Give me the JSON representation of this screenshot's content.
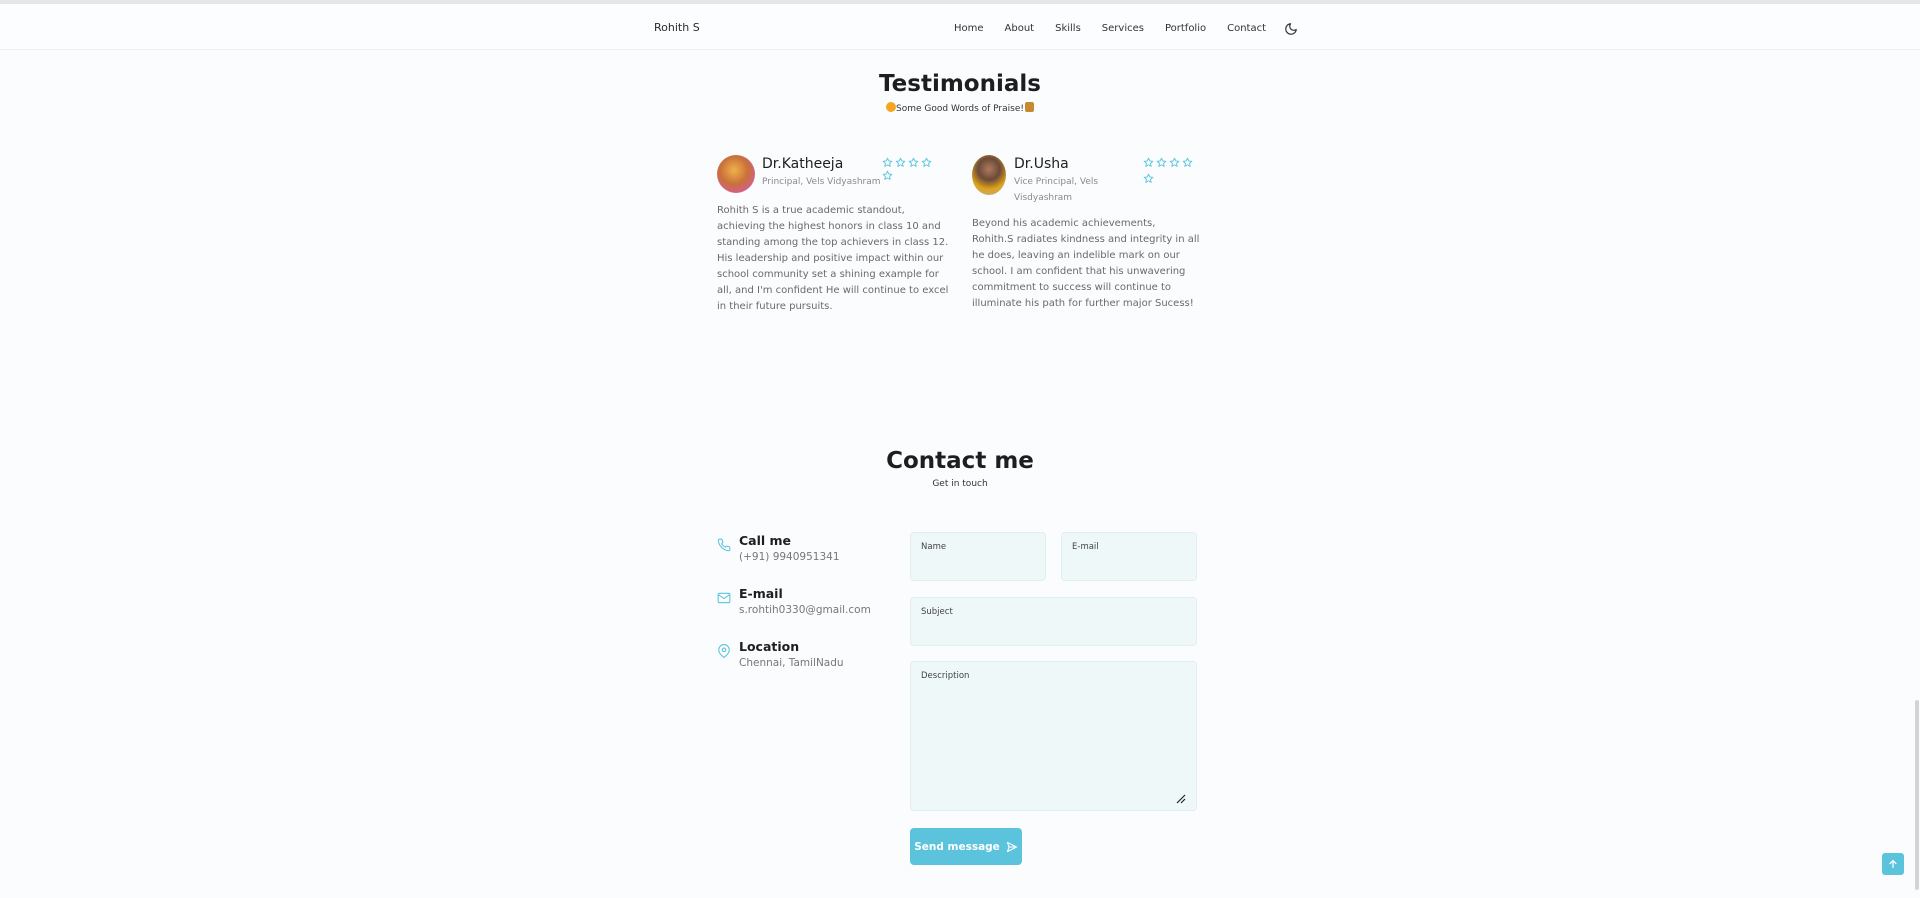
{
  "colors": {
    "accent": "#5bc4dc",
    "field_bg": "#eef8f9"
  },
  "header": {
    "brand": "Rohith S",
    "links": [
      "Home",
      "About",
      "Skills",
      "Services",
      "Portfolio",
      "Contact"
    ],
    "theme_icon": "moon-icon"
  },
  "testimonials": {
    "title": "Testimonials",
    "subtitle": "Some Good Words of Praise!",
    "items": [
      {
        "name": "Dr.Katheeja",
        "role": "Principal, Vels Vidyashram",
        "rating": 5,
        "text": "Rohith S is a true academic standout, achieving the highest honors in class 10 and standing among the top achievers in class 12. His leadership and positive impact within our school community set a shining example for all, and I'm confident He will continue to excel in their future pursuits."
      },
      {
        "name": "Dr.Usha",
        "role": "Vice Principal, Vels Visdyashram",
        "rating": 5,
        "text": "Beyond his academic achievements, Rohith.S radiates kindness and integrity in all he does, leaving an indelible mark on our school. I am confident that his unwavering commitment to success will continue to illuminate his path for further major Sucess!"
      }
    ]
  },
  "contact": {
    "title": "Contact me",
    "subtitle": "Get in touch",
    "info": [
      {
        "icon": "phone-icon",
        "title": "Call me",
        "value": "(+91) 9940951341"
      },
      {
        "icon": "mail-icon",
        "title": "E-mail",
        "value": "s.rohtih0330@gmail.com"
      },
      {
        "icon": "map-pin-icon",
        "title": "Location",
        "value": "Chennai, TamilNadu"
      }
    ],
    "form": {
      "name_label": "Name",
      "email_label": "E-mail",
      "subject_label": "Subject",
      "description_label": "Description",
      "name_value": "",
      "email_value": "",
      "subject_value": "",
      "description_value": "",
      "send_label": "Send message"
    }
  }
}
